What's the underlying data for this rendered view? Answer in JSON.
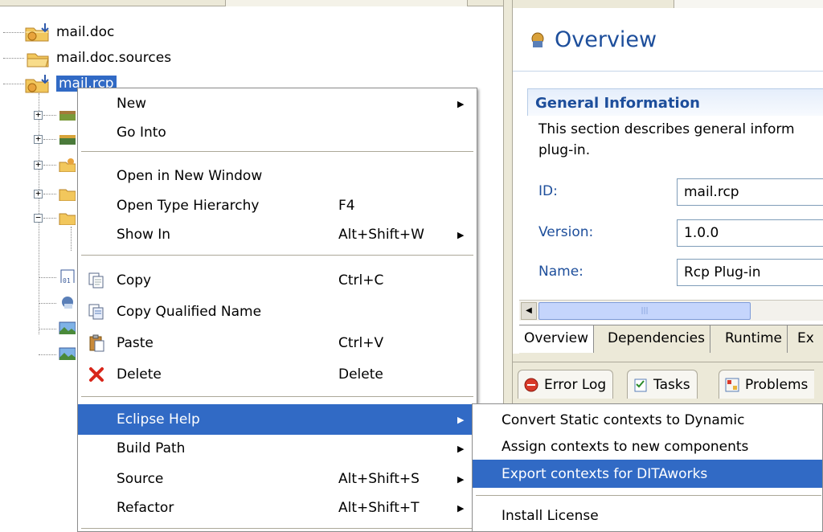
{
  "tree": {
    "items": [
      {
        "label": "mail.doc"
      },
      {
        "label": "mail.doc.sources"
      },
      {
        "label": "mail.rcp"
      }
    ]
  },
  "context_menu": {
    "items": [
      {
        "label": "New",
        "shortcut": "",
        "submenu": true
      },
      {
        "label": "Go Into",
        "shortcut": ""
      },
      {
        "label": "Open in New Window",
        "shortcut": ""
      },
      {
        "label": "Open Type Hierarchy",
        "shortcut": "F4"
      },
      {
        "label": "Show In",
        "shortcut": "Alt+Shift+W",
        "submenu": true
      },
      {
        "label": "Copy",
        "shortcut": "Ctrl+C",
        "icon": "copy-icon"
      },
      {
        "label": "Copy Qualified Name",
        "shortcut": "",
        "icon": "copy-qualified-name-icon"
      },
      {
        "label": "Paste",
        "shortcut": "Ctrl+V",
        "icon": "paste-icon"
      },
      {
        "label": "Delete",
        "shortcut": "Delete",
        "icon": "delete-icon"
      },
      {
        "label": "Eclipse Help",
        "shortcut": "",
        "submenu": true,
        "highlighted": true
      },
      {
        "label": "Build Path",
        "shortcut": "",
        "submenu": true
      },
      {
        "label": "Source",
        "shortcut": "Alt+Shift+S",
        "submenu": true
      },
      {
        "label": "Refactor",
        "shortcut": "Alt+Shift+T",
        "submenu": true
      }
    ]
  },
  "submenu": {
    "items": [
      {
        "label": "Convert Static contexts to Dynamic"
      },
      {
        "label": "Assign contexts to new components"
      },
      {
        "label": "Export contexts for DITAworks",
        "highlighted": true
      },
      {
        "label": "Install License"
      }
    ]
  },
  "editor": {
    "title": "Overview",
    "section_title": "General Information",
    "description_line1": "This section describes general inform",
    "description_line2": "plug-in.",
    "fields": [
      {
        "label": "ID:",
        "value": "mail.rcp"
      },
      {
        "label": "Version:",
        "value": "1.0.0"
      },
      {
        "label": "Name:",
        "value": "Rcp Plug-in"
      }
    ],
    "tabs": [
      {
        "label": "Overview"
      },
      {
        "label": "Dependencies"
      },
      {
        "label": "Runtime"
      },
      {
        "label": "Ex"
      }
    ]
  },
  "views": {
    "tabs": [
      {
        "label": "Error Log"
      },
      {
        "label": "Tasks"
      },
      {
        "label": "Problems"
      }
    ]
  },
  "colors": {
    "selection": "#316ac5",
    "menu_border": "#8c8c8c",
    "form_title": "#1d4e9b",
    "chrome": "#ece9d8"
  }
}
